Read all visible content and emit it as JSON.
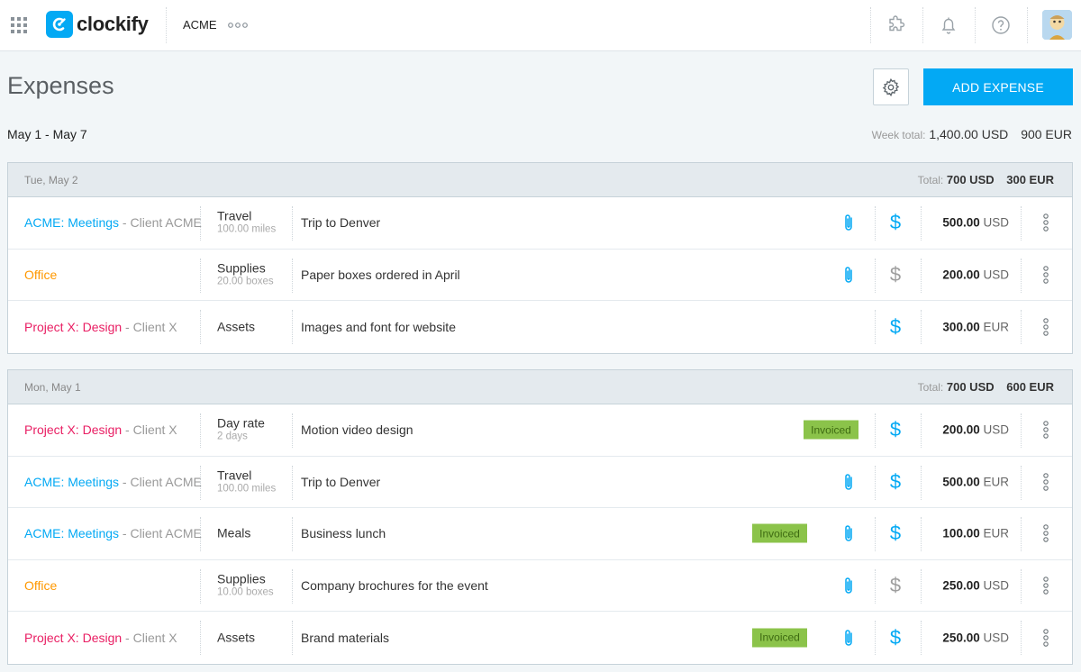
{
  "topbar": {
    "app_name": "clockify",
    "workspace": "ACME",
    "icons": [
      "apps-grid-icon",
      "puzzle-icon",
      "bell-icon",
      "help-icon",
      "more-horizontal-icon"
    ]
  },
  "header": {
    "title": "Expenses",
    "add_button": "ADD EXPENSE",
    "date_range": "May 1 - May 7",
    "week_total_label": "Week total:",
    "week_total_usd": "1,400.00 USD",
    "week_total_eur": "900 EUR"
  },
  "colors": {
    "accent": "#03a9f4",
    "acme": "#03a9f4",
    "office": "#ff9800",
    "project_x": "#e91e63",
    "invoiced": "#8bc34a"
  },
  "groups": [
    {
      "date": "Tue, May 2",
      "total_label": "Total:",
      "total_a": "700 USD",
      "total_b": "300 EUR",
      "rows": [
        {
          "project": "ACME: Meetings",
          "client": " - Client ACME",
          "project_color": "#03a9f4",
          "category": "Travel",
          "category_sub": "100.00 miles",
          "description": "Trip to Denver",
          "invoiced": false,
          "attachment": true,
          "billable": true,
          "amount": "500.00",
          "currency": "USD"
        },
        {
          "project": "Office",
          "client": "",
          "project_color": "#ff9800",
          "category": "Supplies",
          "category_sub": "20.00 boxes",
          "description": "Paper boxes ordered in April",
          "invoiced": false,
          "attachment": true,
          "billable": false,
          "amount": "200.00",
          "currency": "USD"
        },
        {
          "project": "Project X: Design",
          "client": " - Client X",
          "project_color": "#e91e63",
          "category": "Assets",
          "category_sub": "",
          "description": "Images and font for website",
          "invoiced": false,
          "attachment": false,
          "billable": true,
          "amount": "300.00",
          "currency": "EUR"
        }
      ]
    },
    {
      "date": "Mon, May 1",
      "total_label": "Total:",
      "total_a": "700 USD",
      "total_b": "600 EUR",
      "rows": [
        {
          "project": "Project X: Design",
          "client": " - Client X",
          "project_color": "#e91e63",
          "category": "Day rate",
          "category_sub": "2 days",
          "description": "Motion video design",
          "invoiced": true,
          "attachment": false,
          "billable": true,
          "amount": "200.00",
          "currency": "USD"
        },
        {
          "project": "ACME: Meetings",
          "client": " - Client ACME",
          "project_color": "#03a9f4",
          "category": "Travel",
          "category_sub": "100.00 miles",
          "description": "Trip to Denver",
          "invoiced": false,
          "attachment": true,
          "billable": true,
          "amount": "500.00",
          "currency": "EUR"
        },
        {
          "project": "ACME: Meetings",
          "client": " - Client ACME",
          "project_color": "#03a9f4",
          "category": "Meals",
          "category_sub": "",
          "description": "Business lunch",
          "invoiced": true,
          "attachment": true,
          "billable": true,
          "amount": "100.00",
          "currency": "EUR"
        },
        {
          "project": "Office",
          "client": "",
          "project_color": "#ff9800",
          "category": "Supplies",
          "category_sub": "10.00 boxes",
          "description": "Company brochures for the event",
          "invoiced": false,
          "attachment": true,
          "billable": false,
          "amount": "250.00",
          "currency": "USD"
        },
        {
          "project": "Project X: Design",
          "client": " - Client X",
          "project_color": "#e91e63",
          "category": "Assets",
          "category_sub": "",
          "description": "Brand materials",
          "invoiced": true,
          "attachment": true,
          "billable": true,
          "amount": "250.00",
          "currency": "USD"
        }
      ]
    }
  ],
  "badge_label": "Invoiced"
}
